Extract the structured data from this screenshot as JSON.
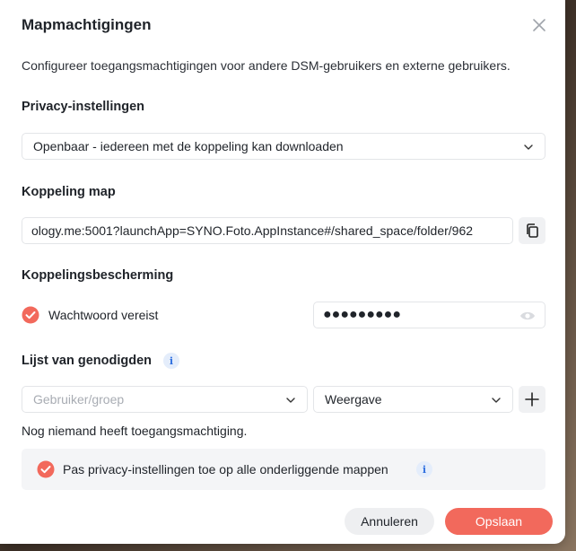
{
  "dialog": {
    "title": "Mapmachtigingen",
    "description": "Configureer toegangsmachtigingen voor andere DSM-gebruikers en externe gebruikers."
  },
  "privacy": {
    "label": "Privacy-instellingen",
    "selected": "Openbaar - iedereen met de koppeling kan downloaden"
  },
  "link": {
    "label": "Koppeling map",
    "value": "ology.me:5001?launchApp=SYNO.Foto.AppInstance#/shared_space/folder/962"
  },
  "protection": {
    "label": "Koppelingsbescherming",
    "password_required_label": "Wachtwoord vereist",
    "password_required_checked": true,
    "password_mask": "●●●●●●●●●"
  },
  "invitees": {
    "label": "Lijst van genodigden",
    "user_placeholder": "Gebruiker/groep",
    "permission_selected": "Weergave",
    "empty_note": "Nog niemand heeft toegangsmachtiging."
  },
  "subfolders": {
    "label": "Pas privacy-instellingen toe op alle onderliggende mappen",
    "checked": true
  },
  "buttons": {
    "cancel": "Annuleren",
    "save": "Opslaan"
  },
  "colors": {
    "accent": "#f2695c",
    "info": "#2f6fdf"
  }
}
